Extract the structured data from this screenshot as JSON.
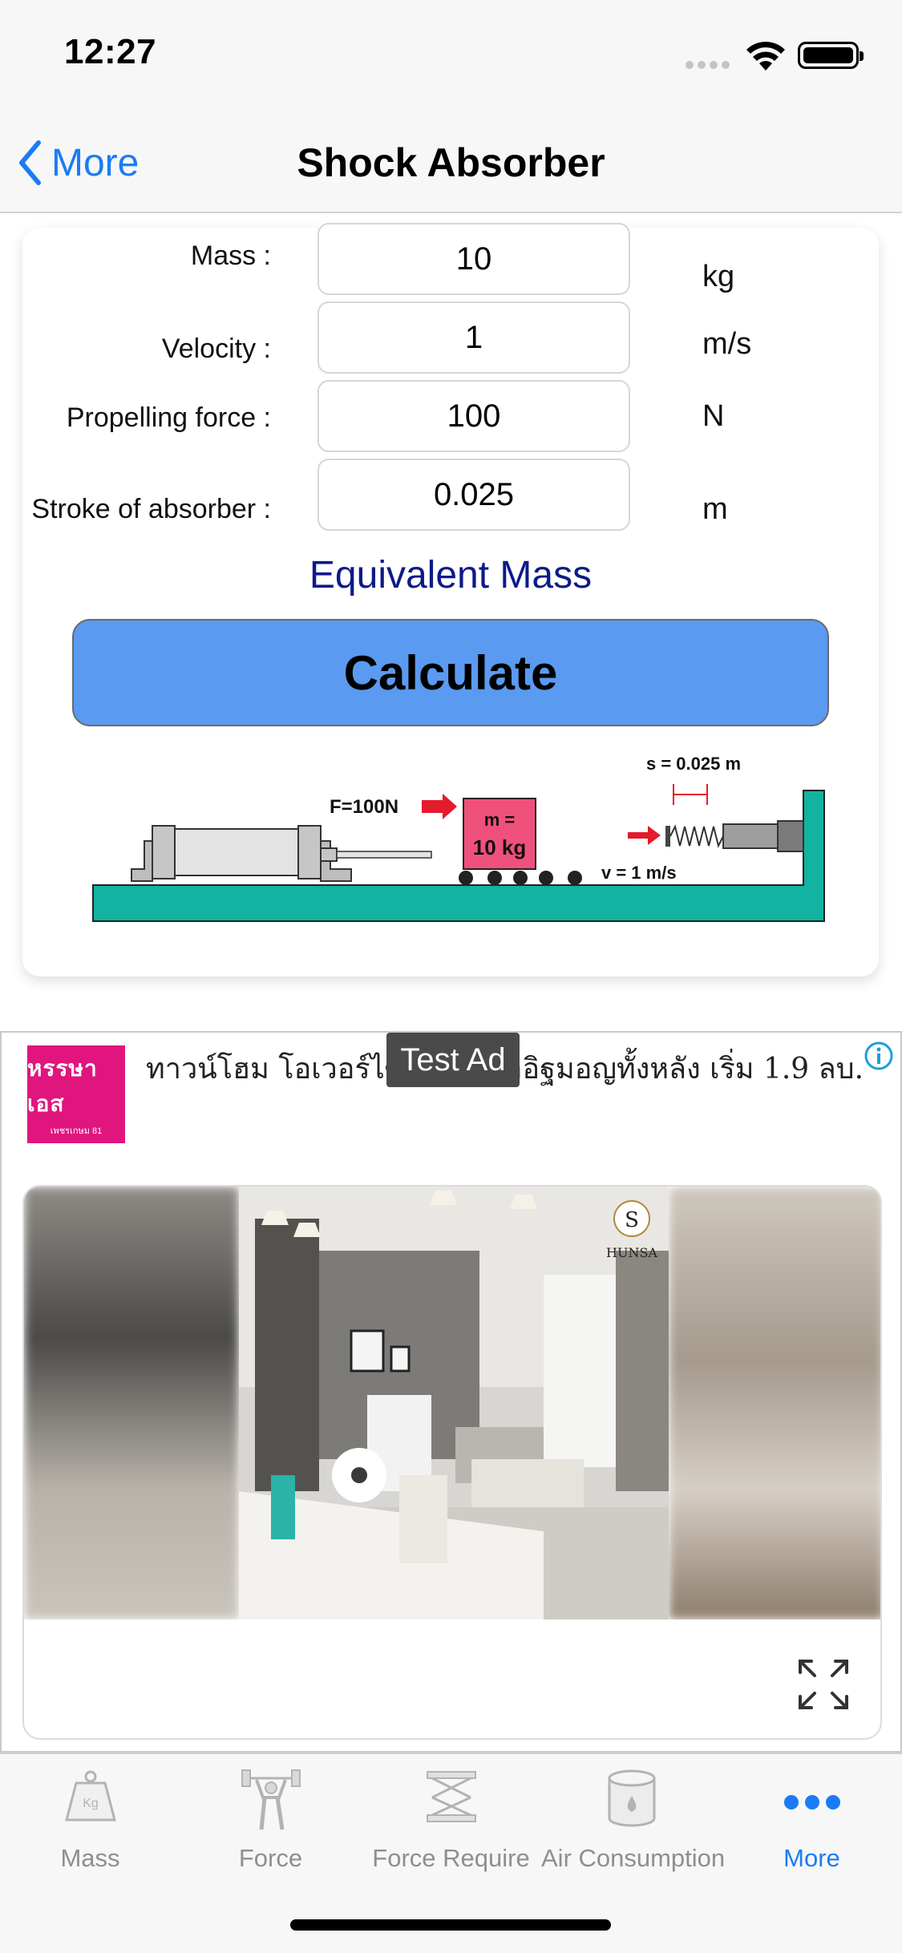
{
  "status_bar": {
    "time": "12:27"
  },
  "nav": {
    "back_label": "More",
    "title": "Shock Absorber"
  },
  "form": {
    "rows": [
      {
        "label": "Mass :",
        "value": "10",
        "unit": "kg"
      },
      {
        "label": "Velocity :",
        "value": "1",
        "unit": "m/s"
      },
      {
        "label": "Propelling force :",
        "value": "100",
        "unit": "N"
      },
      {
        "label": "Stroke of absorber :",
        "value": "0.025",
        "unit": "m"
      }
    ],
    "result_label": "Equivalent Mass",
    "calculate_label": "Calculate"
  },
  "diagram": {
    "force_label": "F=100N",
    "mass_label_1": "m =",
    "mass_label_2": "10 kg",
    "stroke_label": "s = 0.025 m",
    "velocity_label": "v = 1 m/s"
  },
  "ad": {
    "badge": "Test Ad",
    "logo_title": "หรรษาเอส",
    "logo_sub": "เพชรเกษม 81",
    "text": "ทาวน์โฮม โอเวอร์ไซ    ม 81 ก่ออิฐมอญทั้งหลัง เริ่ม 1.9 ลบ.",
    "image_brand": "HUNSA"
  },
  "tabs": [
    {
      "label": "Mass",
      "icon": "weight-icon",
      "active": false
    },
    {
      "label": "Force",
      "icon": "weightlifter-icon",
      "active": false
    },
    {
      "label": "Force Require",
      "icon": "scissor-lift-icon",
      "active": false
    },
    {
      "label": "Air Consumption",
      "icon": "air-tank-icon",
      "active": false
    },
    {
      "label": "More",
      "icon": "more-dots-icon",
      "active": true
    }
  ],
  "colors": {
    "accent": "#1a7cf5",
    "calculate_button": "#5a9af0",
    "result_text": "#0d1a8a",
    "diagram_base": "#12b3a0",
    "diagram_mass": "#f0507c"
  }
}
